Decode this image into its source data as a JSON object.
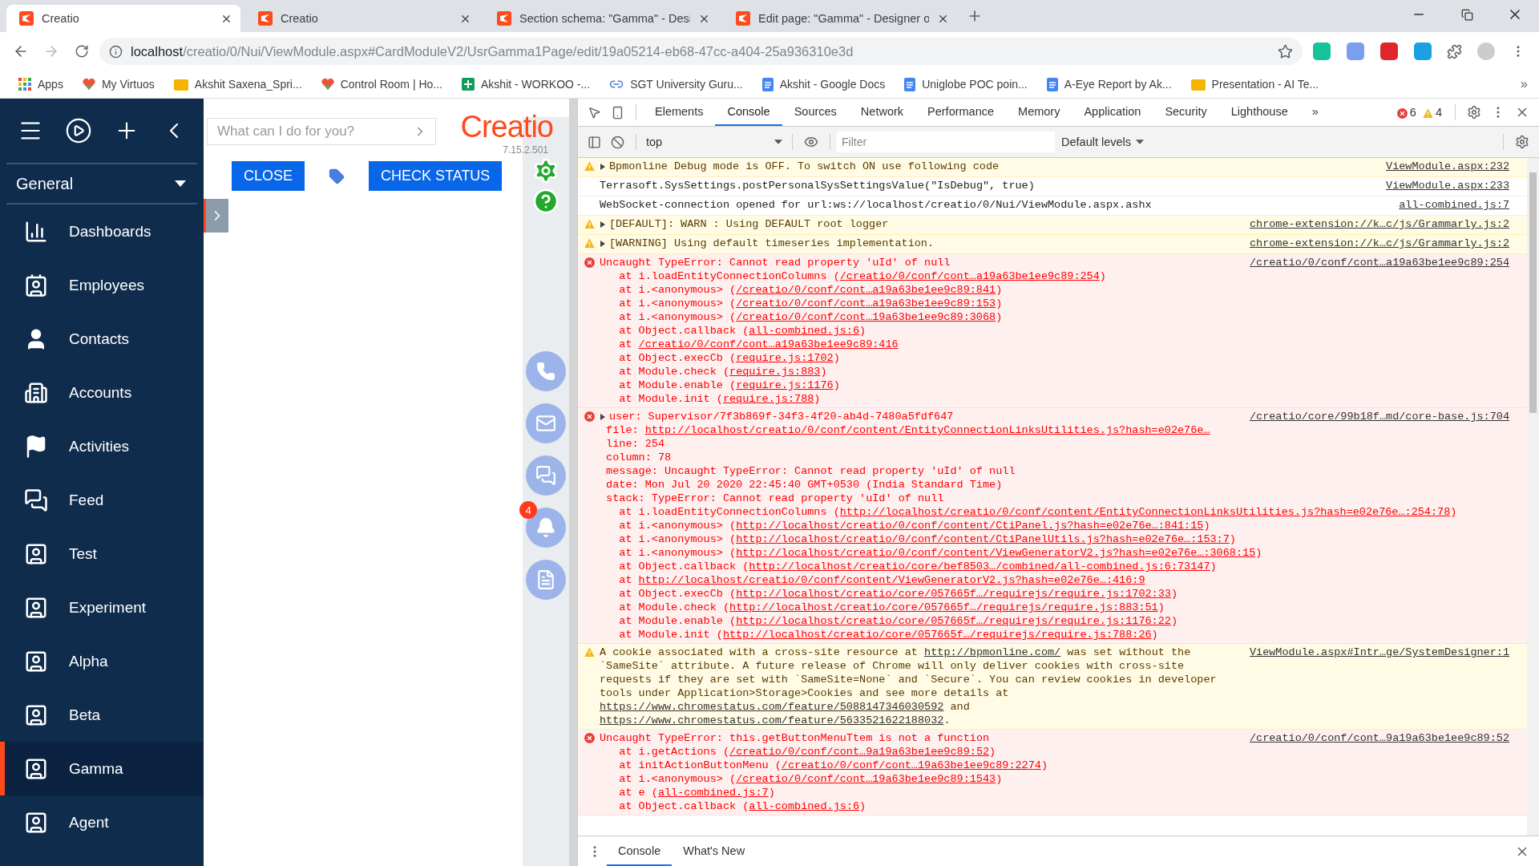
{
  "browser": {
    "tabs": [
      {
        "title": "Creatio",
        "selected": true
      },
      {
        "title": "Creatio",
        "selected": false
      },
      {
        "title": "Section schema: \"Gamma\" - Desi",
        "selected": false
      },
      {
        "title": "Edit page: \"Gamma\" - Designer o",
        "selected": false
      }
    ],
    "address": {
      "host": "localhost",
      "path": "/creatio/0/Nui/ViewModule.aspx#CardModuleV2/UsrGamma1Page/edit/19a05214-eb68-47cc-a404-25a936310e3d"
    },
    "bookmarks": [
      {
        "label": "Apps",
        "kind": "apps"
      },
      {
        "label": "My Virtuos",
        "kind": "site"
      },
      {
        "label": "Akshit Saxena_Spri...",
        "kind": "folder"
      },
      {
        "label": "Control Room | Ho...",
        "kind": "site"
      },
      {
        "label": "Akshit - WORKOO -...",
        "kind": "sheet"
      },
      {
        "label": "SGT University Guru...",
        "kind": "link"
      },
      {
        "label": "Akshit - Google Docs",
        "kind": "doc"
      },
      {
        "label": "Uniglobe POC poin...",
        "kind": "doc"
      },
      {
        "label": "A-Eye Report by Ak...",
        "kind": "doc"
      },
      {
        "label": "Presentation - AI Te...",
        "kind": "folder"
      }
    ],
    "bookmarks_more": "»"
  },
  "creatio": {
    "section": "General",
    "sidebar_items": [
      {
        "label": "Dashboards",
        "kind": "chart",
        "selected": false
      },
      {
        "label": "Employees",
        "kind": "badge",
        "selected": false
      },
      {
        "label": "Contacts",
        "kind": "person",
        "selected": false
      },
      {
        "label": "Accounts",
        "kind": "building",
        "selected": false
      },
      {
        "label": "Activities",
        "kind": "flag",
        "selected": false
      },
      {
        "label": "Feed",
        "kind": "chat",
        "selected": false
      },
      {
        "label": "Test",
        "kind": "card",
        "selected": false
      },
      {
        "label": "Experiment",
        "kind": "card",
        "selected": false
      },
      {
        "label": "Alpha",
        "kind": "card",
        "selected": false
      },
      {
        "label": "Beta",
        "kind": "card",
        "selected": false
      },
      {
        "label": "Gamma",
        "kind": "card",
        "selected": true
      },
      {
        "label": "Agent",
        "kind": "card",
        "selected": false
      }
    ],
    "search": {
      "placeholder": "What can I do for you?"
    },
    "logo": "Creatio",
    "version": "7.15.2.501",
    "buttons": [
      "CLOSE",
      "CHECK STATUS"
    ],
    "notifications": "4"
  },
  "devtools": {
    "tabs": [
      {
        "label": "Elements",
        "selected": false
      },
      {
        "label": "Console",
        "selected": true
      },
      {
        "label": "Sources",
        "selected": false
      },
      {
        "label": "Network",
        "selected": false
      },
      {
        "label": "Performance",
        "selected": false
      },
      {
        "label": "Memory",
        "selected": false
      },
      {
        "label": "Application",
        "selected": false
      },
      {
        "label": "Security",
        "selected": false
      },
      {
        "label": "Lighthouse",
        "selected": false
      }
    ],
    "more": "»",
    "errors": "6",
    "warnings": "4",
    "context": "top",
    "filter": {
      "placeholder": "Filter"
    },
    "levels": "Default levels",
    "messages": [
      {
        "kind": "warning",
        "expandable": true,
        "text": "Bpmonline Debug mode is OFF. To switch ON use following code",
        "source": "ViewModule.aspx:232"
      },
      {
        "kind": "info",
        "expandable": false,
        "text": "Terrasoft.SysSettings.postPersonalSysSettingsValue(\"IsDebug\", true)",
        "source": "ViewModule.aspx:233"
      },
      {
        "kind": "info",
        "expandable": false,
        "text": "WebSocket-connection opened for url:ws://localhost/creatio/0/Nui/ViewModule.aspx.ashx",
        "source": "all-combined.js:7"
      },
      {
        "kind": "warning",
        "expandable": true,
        "text": "[DEFAULT]: WARN : Using DEFAULT root logger",
        "source": "chrome-extension://k…c/js/Grammarly.js:2"
      },
      {
        "kind": "warning",
        "expandable": true,
        "text": "[WARNING] Using default timeseries implementation.",
        "source": "chrome-extension://k…c/js/Grammarly.js:2"
      },
      {
        "kind": "error",
        "expandable": false,
        "text": "Uncaught TypeError: Cannot read property 'uId' of null",
        "source": "/creatio/0/conf/cont…a19a63be1ee9c89:254",
        "frames": [
          {
            "text": "at i.loadEntityConnectionColumns (",
            "link": "/creatio/0/conf/cont…a19a63be1ee9c89:254",
            "after": ")"
          },
          {
            "text": "at i.<anonymous> (",
            "link": "/creatio/0/conf/cont…a19a63be1ee9c89:841",
            "after": ")"
          },
          {
            "text": "at i.<anonymous> (",
            "link": "/creatio/0/conf/cont…a19a63be1ee9c89:153",
            "after": ")"
          },
          {
            "text": "at i.<anonymous> (",
            "link": "/creatio/0/conf/cont…19a63be1ee9c89:3068",
            "after": ")"
          },
          {
            "text": "at Object.callback (",
            "link": "all-combined.js:6",
            "after": ")"
          },
          {
            "text": "at ",
            "link": "/creatio/0/conf/cont…a19a63be1ee9c89:416"
          },
          {
            "text": "at Object.execCb (",
            "link": "require.js:1702",
            "after": ")"
          },
          {
            "text": "at Module.check (",
            "link": "require.js:883",
            "after": ")"
          },
          {
            "text": "at Module.enable (",
            "link": "require.js:1176",
            "after": ")"
          },
          {
            "text": "at Module.init (",
            "link": "require.js:788",
            "after": ")"
          }
        ]
      },
      {
        "kind": "error",
        "expandable": true,
        "text": "user: Supervisor/7f3b869f-34f3-4f20-ab4d-7480a5fdf647",
        "source": "/creatio/core/99b18f…md/core-base.js:704",
        "props": [
          {
            "text": "file: ",
            "link": "http://localhost/creatio/0/conf/content/EntityConnectionLinksUtilities.js?hash=e02e76e…"
          },
          {
            "text": "line: 254"
          },
          {
            "text": "column: 78"
          },
          {
            "text": "message: Uncaught TypeError: Cannot read property 'uId' of null"
          },
          {
            "text": "date: Mon Jul 20 2020 22:45:40 GMT+0530 (India Standard Time)"
          },
          {
            "text": "stack: TypeError: Cannot read property 'uId' of null",
            "children": [
              {
                "text": "at i.loadEntityConnectionColumns (",
                "link": "http://localhost/creatio/0/conf/content/EntityConnectionLinksUtilities.js?hash=e02e76e…:254:78",
                "after": ")"
              },
              {
                "text": "at i.<anonymous> (",
                "link": "http://localhost/creatio/0/conf/content/CtiPanel.js?hash=e02e76e…:841:15",
                "after": ")"
              },
              {
                "text": "at i.<anonymous> (",
                "link": "http://localhost/creatio/0/conf/content/CtiPanelUtils.js?hash=e02e76e…:153:7",
                "after": ")"
              },
              {
                "text": "at i.<anonymous> (",
                "link": "http://localhost/creatio/0/conf/content/ViewGeneratorV2.js?hash=e02e76e…:3068:15",
                "after": ")"
              },
              {
                "text": "at Object.callback (",
                "link": "http://localhost/creatio/core/bef8503…/combined/all-combined.js:6:73147",
                "after": ")"
              },
              {
                "text": "at ",
                "link": "http://localhost/creatio/0/conf/content/ViewGeneratorV2.js?hash=e02e76e…:416:9"
              },
              {
                "text": "at Object.execCb (",
                "link": "http://localhost/creatio/core/057665f…/requirejs/require.js:1702:33",
                "after": ")"
              },
              {
                "text": "at Module.check (",
                "link": "http://localhost/creatio/core/057665f…/requirejs/require.js:883:51",
                "after": ")"
              },
              {
                "text": "at Module.enable (",
                "link": "http://localhost/creatio/core/057665f…/requirejs/require.js:1176:22",
                "after": ")"
              },
              {
                "text": "at Module.init (",
                "link": "http://localhost/creatio/core/057665f…/requirejs/require.js:788:26",
                "after": ")"
              }
            ]
          }
        ]
      },
      {
        "kind": "warning",
        "expandable": false,
        "parts": [
          {
            "text": "A cookie associated with a cross-site resource at "
          },
          {
            "link": "http://bpmonline.com/"
          },
          {
            "text": " was set without the `SameSite` attribute. A future release of Chrome will only deliver cookies with cross-site requests if they are set with `SameSite=None` and `Secure`. You can review cookies in developer tools under Application>Storage>Cookies and see more details at "
          },
          {
            "link": "https://www.chromestatus.com/feature/5088147346030592"
          },
          {
            "text": " and "
          },
          {
            "link": "https://www.chromestatus.com/feature/5633521622188032"
          },
          {
            "text": "."
          }
        ],
        "source": "ViewModule.aspx#Intr…ge/SystemDesigner:1"
      },
      {
        "kind": "error",
        "expandable": false,
        "text": "Uncaught TypeError: this.getButtonMenuTtem is not a function",
        "source": "/creatio/0/conf/cont…9a19a63be1ee9c89:52",
        "frames": [
          {
            "text": "at i.getActions (",
            "link": "/creatio/0/conf/cont…9a19a63be1ee9c89:52",
            "after": ")"
          },
          {
            "text": "at initActionButtonMenu (",
            "link": "/creatio/0/conf/cont…19a63be1ee9c89:2274",
            "after": ")"
          },
          {
            "text": "at i.<anonymous> (",
            "link": "/creatio/0/conf/cont…19a63be1ee9c89:1543",
            "after": ")"
          },
          {
            "text": "at e (",
            "link": "all-combined.js:7",
            "after": ")"
          },
          {
            "text": "at Object.callback (",
            "link": "all-combined.js:6",
            "after": ")"
          }
        ]
      }
    ],
    "drawer_tabs": [
      {
        "label": "Console",
        "selected": true
      },
      {
        "label": "What's New",
        "selected": false
      }
    ]
  }
}
